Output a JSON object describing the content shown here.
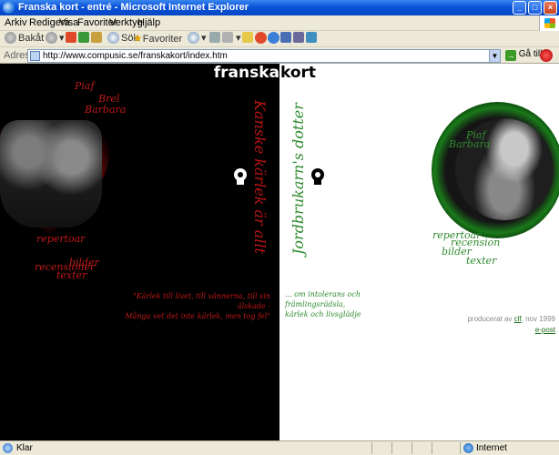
{
  "window": {
    "title": "Franska kort - entré - Microsoft Internet Explorer"
  },
  "menu": {
    "items": [
      "Arkiv",
      "Redigera",
      "Visa",
      "Favoriter",
      "Verktyg",
      "Hjälp"
    ]
  },
  "toolbar": {
    "back_label": "Bakåt",
    "search_label": "Sök",
    "favorites_label": "Favoriter"
  },
  "address": {
    "label": "Adress",
    "url": "http://www.compusic.se/franskakort/index.htm",
    "go_label": "Gå till"
  },
  "page": {
    "title_left": "franska",
    "title_right": "kort",
    "left": {
      "names": [
        "Piaf",
        "Brel",
        "Barbara"
      ],
      "nav": [
        "repertoar",
        "bilder",
        "recensioner",
        "texter"
      ],
      "vertical": "Kanske kärlek är allt",
      "quote_lines": [
        "\"Kärlek till livet, till vännerna, till sin älskade -",
        "Många vet det inte kärlek, men tog fel\""
      ]
    },
    "right": {
      "vertical": "Jordbrukarn's dotter",
      "quote_lines": [
        "... om intolerans och främlingsrädsla,",
        "kärlek och livsglädje"
      ],
      "names": [
        "Piaf",
        "Barbara"
      ],
      "nav": [
        "repertoar",
        "recension",
        "bilder",
        "texter"
      ],
      "credits_prefix": "producerat av",
      "credits_link": "clf",
      "credits_suffix": ", nov 1999",
      "email_label": "e-post"
    }
  },
  "status": {
    "left": "Klar",
    "zone": "Internet"
  },
  "colors": {
    "red": "#c01818",
    "green": "#2f8a2f",
    "xp_blue": "#0a52d8"
  }
}
